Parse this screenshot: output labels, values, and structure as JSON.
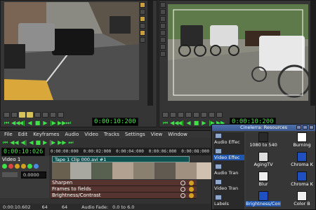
{
  "viewer": {
    "timecode": "0:00:10:200"
  },
  "compositor": {
    "timecode": "0:00:10:200"
  },
  "main": {
    "menu": [
      "File",
      "Edit",
      "Keyframes",
      "Audio",
      "Video",
      "Tracks",
      "Settings",
      "View",
      "Window"
    ],
    "timecode": "0:00:10:026",
    "ruler_ticks": [
      "0:00:00:000",
      "0:00:02:000",
      "0:00:04:000",
      "0:00:06:000",
      "0:00:08:000"
    ],
    "track_name": "Video 1",
    "fade_value": "0.0000",
    "clip_title": "Tape 1    Clip 000.avi #1",
    "effects": [
      "Sharpen",
      "Frames to fields",
      "Brightness/Contrast"
    ],
    "status": {
      "time": "0:00:10.602",
      "val1": "64",
      "val2": "64",
      "audio_fade": "Audio Fade:",
      "range": "0.0 to 6.0"
    }
  },
  "resources": {
    "title": "Cinelerra: Resources",
    "folders": [
      "Audio Effec",
      "Video Effec",
      "Audio Tran",
      "Video Tran",
      "Labels"
    ],
    "selected_folder": 1,
    "items": [
      "1080 to 540",
      "Burning",
      "AgingTV",
      "Chroma K",
      "Blur",
      "Chroma K",
      "Brightness/Contrast",
      "Color B"
    ],
    "top_labels": [
      "Video",
      "Video"
    ]
  },
  "colors": {
    "timecode_green": "#4fe04f",
    "effect_row": "#55332e",
    "selection_blue": "#1f56b0"
  }
}
